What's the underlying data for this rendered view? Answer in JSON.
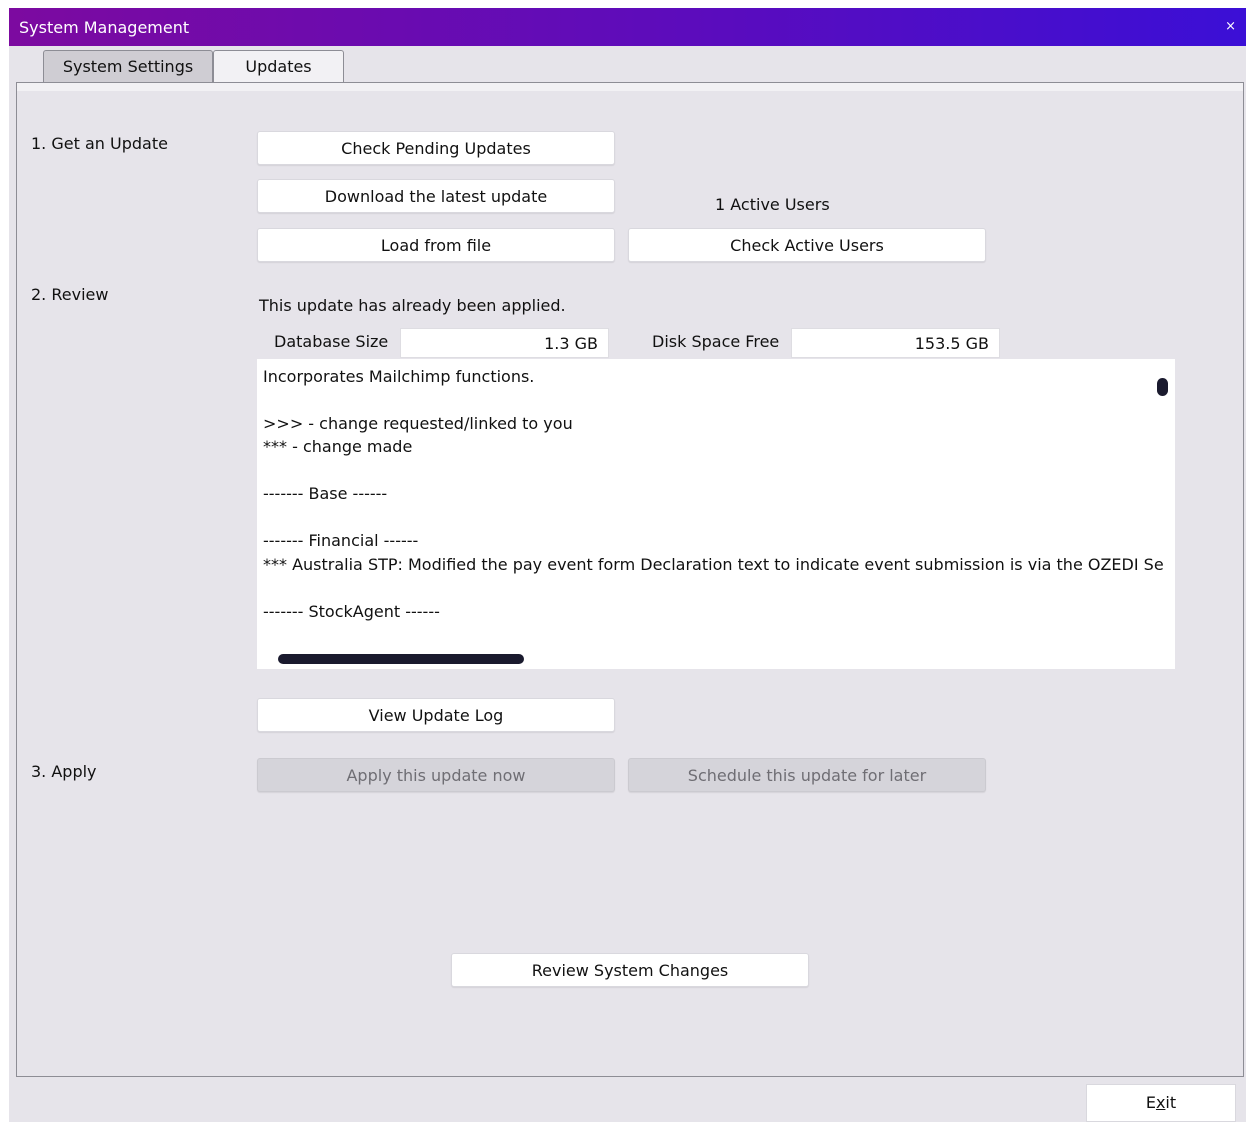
{
  "window": {
    "title": "System Management",
    "close_glyph": "×"
  },
  "tabs": [
    {
      "label": "System Settings",
      "active": false
    },
    {
      "label": "Updates",
      "active": true
    }
  ],
  "sections": {
    "get_update": {
      "heading": "1. Get an Update",
      "check_pending": "Check Pending Updates",
      "download_latest": "Download the latest update",
      "load_from_file": "Load from file",
      "active_users_text": "1 Active Users",
      "check_active_users": "Check Active Users"
    },
    "review": {
      "heading": "2. Review",
      "status": "This update has already been applied.",
      "database_size_label": "Database Size",
      "database_size_value": "1.3 GB",
      "disk_space_label": "Disk Space Free",
      "disk_space_value": "153.5 GB",
      "notes": [
        "Incorporates Mailchimp functions.",
        "",
        ">>> - change requested/linked to you",
        "*** - change made",
        "",
        "------- Base ------",
        "",
        "------- Financial ------",
        "*** Australia STP: Modified the pay event form Declaration text to indicate event submission is via the OZEDI Se",
        "",
        "------- StockAgent ------"
      ],
      "view_log": "View Update Log"
    },
    "apply": {
      "heading": "3. Apply",
      "apply_now": "Apply this update now",
      "schedule_later": "Schedule this update for later"
    }
  },
  "review_changes": "Review System Changes",
  "exit": {
    "pre": "E",
    "accel": "x",
    "post": "it"
  }
}
